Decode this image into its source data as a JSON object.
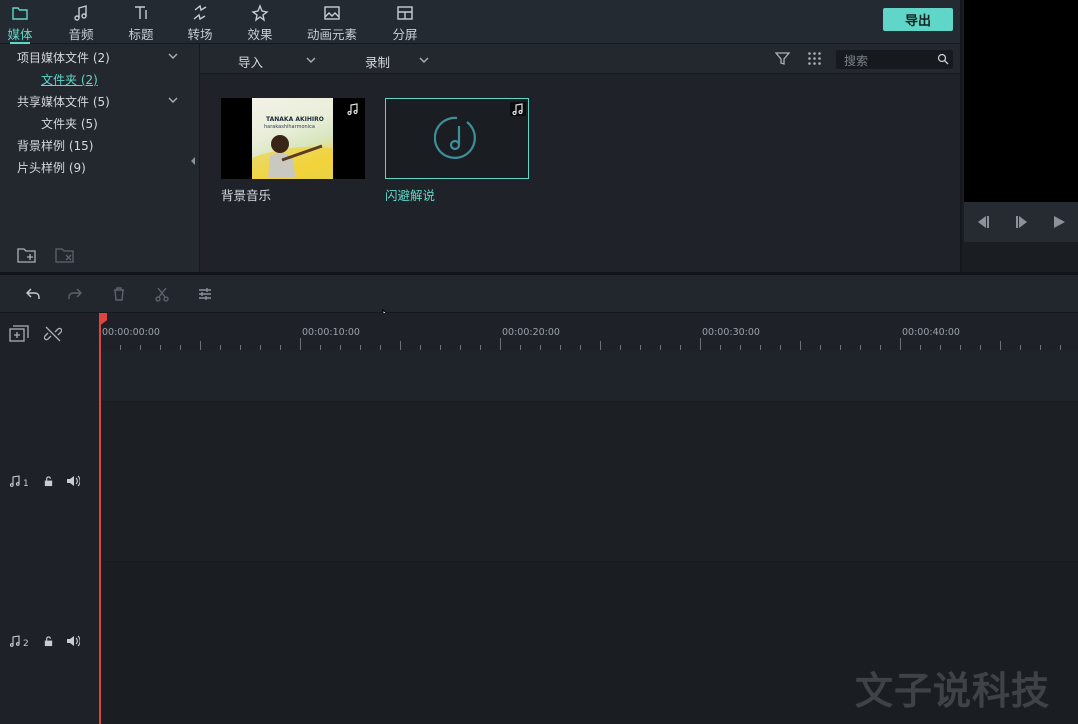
{
  "tabs": [
    {
      "label": "媒体",
      "icon": "folder-icon",
      "active": true
    },
    {
      "label": "音频",
      "icon": "music-note-icon",
      "active": false
    },
    {
      "label": "标题",
      "icon": "text-title-icon",
      "active": false
    },
    {
      "label": "转场",
      "icon": "transition-icon",
      "active": false
    },
    {
      "label": "效果",
      "icon": "effects-icon",
      "active": false
    },
    {
      "label": "动画元素",
      "icon": "image-elements-icon",
      "active": false
    },
    {
      "label": "分屏",
      "icon": "split-screen-icon",
      "active": false
    }
  ],
  "export_label": "导出",
  "library": {
    "items": [
      {
        "label": "项目媒体文件 (2)"
      },
      {
        "label": "文件夹 (2)"
      },
      {
        "label": "共享媒体文件 (5)"
      },
      {
        "label": "文件夹 (5)"
      },
      {
        "label": "背景样例 (15)"
      },
      {
        "label": "片头样例 (9)"
      }
    ]
  },
  "media_toolbar": {
    "import_label": "导入",
    "record_label": "录制",
    "search_placeholder": "搜索"
  },
  "media_items": [
    {
      "label": "背景音乐",
      "album_text_1": "TANAKA AKIHIRO",
      "album_text_2": "harakashiharmonica"
    },
    {
      "label": "闪避解说"
    }
  ],
  "timeline": {
    "timecodes": [
      "00:00:00:00",
      "00:00:10:00",
      "00:00:20:00",
      "00:00:30:00",
      "00:00:40:00"
    ],
    "tracks": [
      {
        "number": "1"
      },
      {
        "number": "2"
      }
    ]
  },
  "colors": {
    "accent": "#5fd6c8",
    "playhead": "#e0443e"
  },
  "watermark": "文子说科技"
}
